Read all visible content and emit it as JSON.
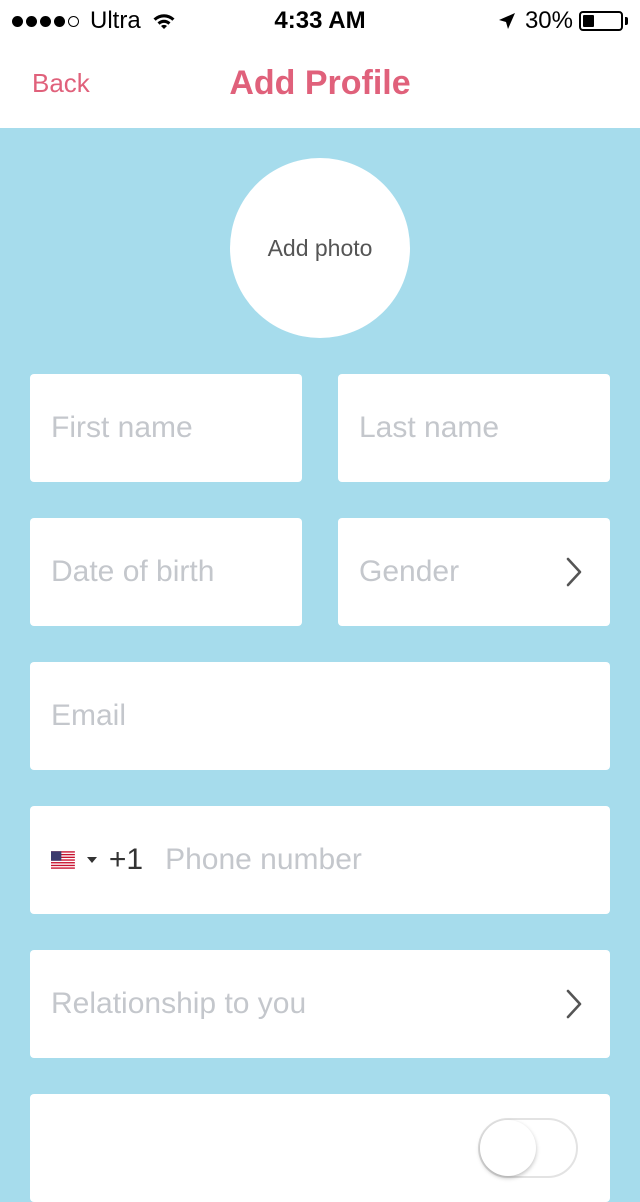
{
  "status_bar": {
    "carrier": "Ultra",
    "time": "4:33 AM",
    "battery": "30%",
    "battery_level": 0.3,
    "signal_bars_filled": 4,
    "signal_bars_total": 5
  },
  "nav": {
    "back_label": "Back",
    "title": "Add Profile"
  },
  "photo": {
    "label": "Add photo"
  },
  "form": {
    "first_name_placeholder": "First name",
    "last_name_placeholder": "Last name",
    "dob_placeholder": "Date of birth",
    "gender_placeholder": "Gender",
    "email_placeholder": "Email",
    "phone_country_code": "+1",
    "phone_placeholder": "Phone number",
    "relationship_placeholder": "Relationship to you"
  },
  "colors": {
    "accent": "#e0617b",
    "background": "#a6dcec",
    "placeholder": "#c4c7cc"
  },
  "icons": [
    "wifi-icon",
    "location-arrow-icon",
    "battery-icon",
    "chevron-right-icon",
    "us-flag-icon",
    "caret-down-icon"
  ]
}
